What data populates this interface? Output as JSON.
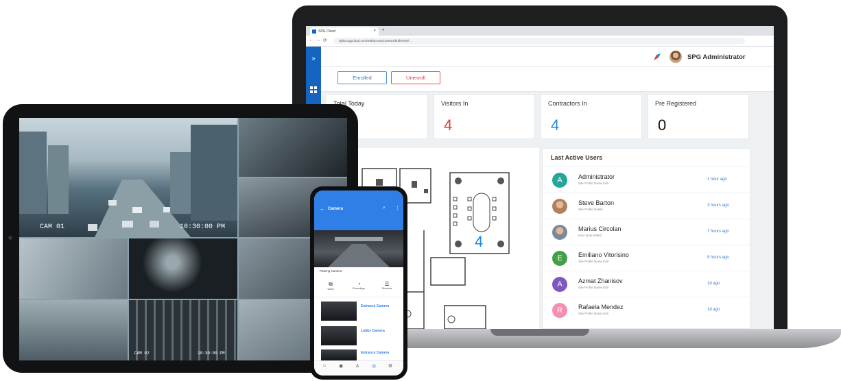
{
  "laptop": {
    "browser": {
      "tab_title": "SPG Cloud",
      "tab_close": "×",
      "new_tab": "+",
      "url": "alpha.spgcloud.com/webaccess/controls/buffer/0/0/…"
    },
    "sidebar_icons": [
      "chevron-right-double-icon",
      "grid-icon"
    ],
    "header": {
      "user_name": "SPG Administrator"
    },
    "toolbar": {
      "enroll_label": "Enrolled",
      "unenroll_label": "Unenroll"
    },
    "stats": [
      {
        "label": "Total Today",
        "value": "",
        "color": "#333333"
      },
      {
        "label": "Visitors In",
        "value": "4",
        "color": "#e53935"
      },
      {
        "label": "Contractors In",
        "value": "4",
        "color": "#1e88e5"
      },
      {
        "label": "Pre Registered",
        "value": "0",
        "color": "#111111"
      }
    ],
    "floor_plan": {
      "room_count": "4"
    },
    "last_active": {
      "title": "Last Active Users",
      "users": [
        {
          "initial": "A",
          "name": "Administrator",
          "sub": "Site Profile Name Edit",
          "time": "1 hour ago",
          "color": "#26a69a",
          "photo": false
        },
        {
          "initial": "",
          "name": "Steve Barton",
          "sub": "Site Profile Delete",
          "time": "3 hours ago",
          "color": "#b08060",
          "photo": true
        },
        {
          "initial": "",
          "name": "Marius Circolan",
          "sub": "Has name edited",
          "time": "7 hours ago",
          "color": "#7a8a9a",
          "photo": true
        },
        {
          "initial": "E",
          "name": "Emiliano Vitorisino",
          "sub": "Site Profile Name Edit",
          "time": "9 hours ago",
          "color": "#43a047",
          "photo": false
        },
        {
          "initial": "A",
          "name": "Azmat Zhanisov",
          "sub": "Site Profile Name Edit",
          "time": "1d ago",
          "color": "#7e57c2",
          "photo": false
        },
        {
          "initial": "R",
          "name": "Rafaela Mendez",
          "sub": "Site Profile Name Edit",
          "time": "1d ago",
          "color": "#f48fb1",
          "photo": false
        }
      ]
    }
  },
  "tablet": {
    "cam_main_label": "CAM 01",
    "cam_main_time": "10:30:00 PM",
    "cam_bottom_label": "CAM 02",
    "cam_bottom_time": "10:30:00 PM"
  },
  "phone": {
    "title": "Camera",
    "caption": "Parking Camera",
    "actions": [
      "Views",
      "Recordings",
      "Shortcuts"
    ],
    "cameras": [
      "Entrance Camera",
      "Lobby Camera",
      "Entrance Camera"
    ]
  }
}
